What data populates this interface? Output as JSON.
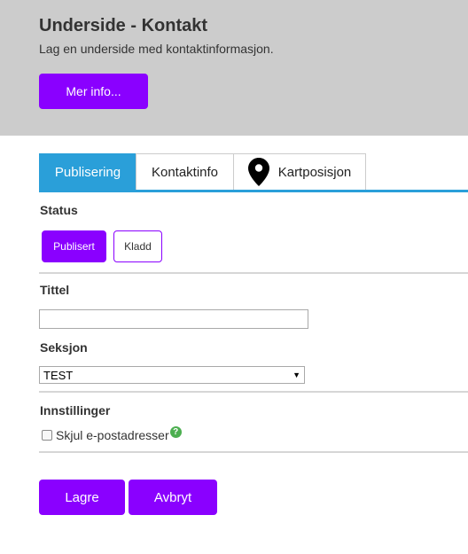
{
  "header": {
    "title": "Underside - Kontakt",
    "subtitle": "Lag en underside med kontaktinformasjon.",
    "more_label": "Mer info..."
  },
  "tabs": [
    {
      "label": "Publisering",
      "active": true
    },
    {
      "label": "Kontaktinfo",
      "active": false
    },
    {
      "label": "Kartposisjon",
      "active": false,
      "icon": "map-pin-icon"
    }
  ],
  "form": {
    "status_label": "Status",
    "status_options": [
      "Publisert",
      "Kladd"
    ],
    "status_selected": "Publisert",
    "title_label": "Tittel",
    "title_value": "",
    "section_label": "Seksjon",
    "section_value": "TEST",
    "settings_label": "Innstillinger",
    "hide_email_label": "Skjul e-postadresser",
    "hide_email_checked": false,
    "help_icon": "?"
  },
  "actions": {
    "save_label": "Lagre",
    "cancel_label": "Avbryt"
  },
  "colors": {
    "accent": "#8a00ff",
    "tab_active": "#2a9fd9",
    "header_bg": "#cccccc",
    "help": "#4caf50"
  }
}
